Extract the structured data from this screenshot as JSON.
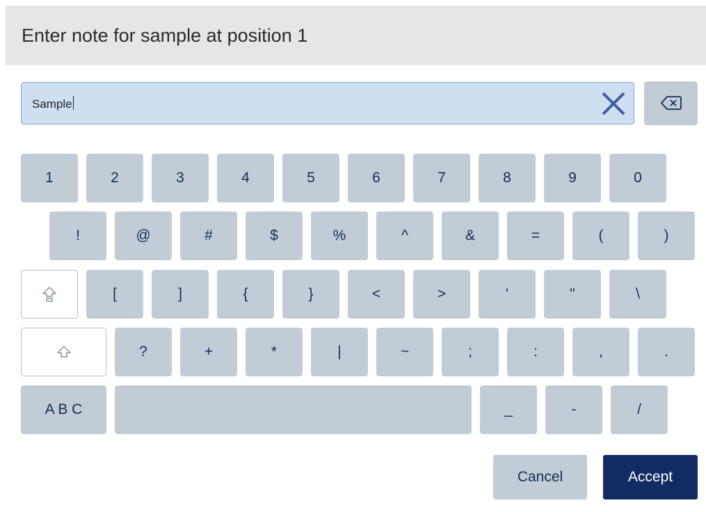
{
  "dialog": {
    "title": "Enter note for sample at position 1"
  },
  "input": {
    "value": "Sample",
    "clear_icon": "close-x-icon"
  },
  "backspace": {
    "icon": "backspace-icon"
  },
  "keyboard": {
    "row1": [
      "1",
      "2",
      "3",
      "4",
      "5",
      "6",
      "7",
      "8",
      "9",
      "0"
    ],
    "row2": [
      "!",
      "@",
      "#",
      "$",
      "%",
      "^",
      "&",
      "=",
      "(",
      ")"
    ],
    "row3": [
      "[",
      "]",
      "{",
      "}",
      "<",
      ">",
      "'",
      "\"",
      "\\"
    ],
    "row4": [
      "?",
      "+",
      "*",
      "|",
      "~",
      ";",
      ":",
      ",",
      "."
    ],
    "row5": [
      "_",
      "-",
      "/"
    ],
    "mode_label": "A B C",
    "caps_lock_icon": "caps-lock-icon",
    "shift_icon": "shift-icon"
  },
  "actions": {
    "cancel_label": "Cancel",
    "accept_label": "Accept"
  },
  "colors": {
    "key": "#c2ccd6",
    "accent": "#132b63",
    "input_bg": "#cfdff2",
    "text": "#1a2b55"
  }
}
